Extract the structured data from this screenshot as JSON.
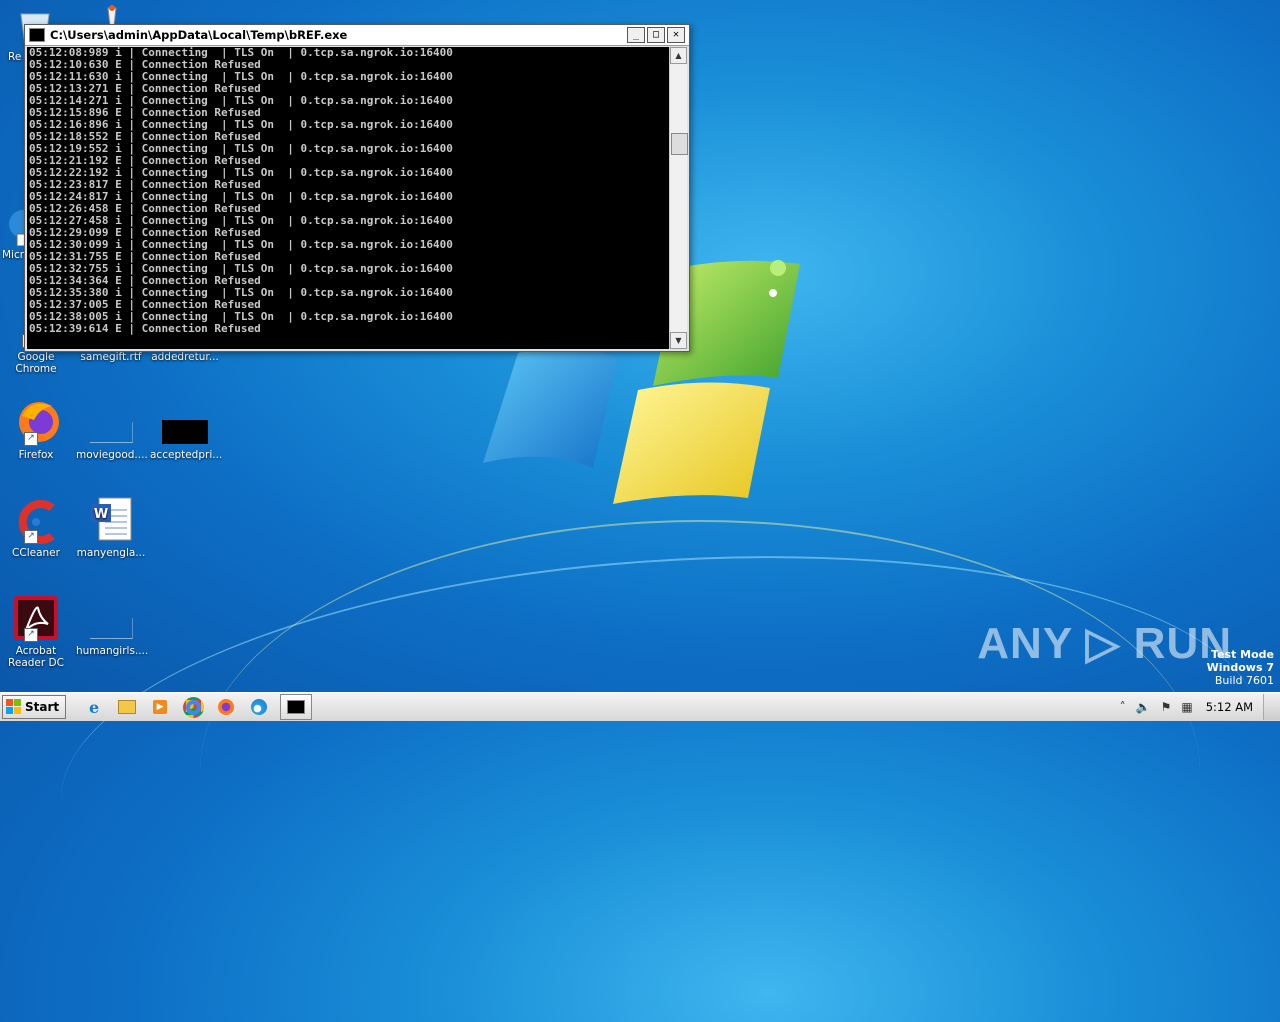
{
  "console": {
    "title": "C:\\Users\\admin\\AppData\\Local\\Temp\\bREF.exe",
    "lines": [
      "05:12:08:989 i | Connecting  | TLS On  | 0.tcp.sa.ngrok.io:16400",
      "05:12:10:630 E | Connection Refused",
      "05:12:11:630 i | Connecting  | TLS On  | 0.tcp.sa.ngrok.io:16400",
      "05:12:13:271 E | Connection Refused",
      "05:12:14:271 i | Connecting  | TLS On  | 0.tcp.sa.ngrok.io:16400",
      "05:12:15:896 E | Connection Refused",
      "05:12:16:896 i | Connecting  | TLS On  | 0.tcp.sa.ngrok.io:16400",
      "05:12:18:552 E | Connection Refused",
      "05:12:19:552 i | Connecting  | TLS On  | 0.tcp.sa.ngrok.io:16400",
      "05:12:21:192 E | Connection Refused",
      "05:12:22:192 i | Connecting  | TLS On  | 0.tcp.sa.ngrok.io:16400",
      "05:12:23:817 E | Connection Refused",
      "05:12:24:817 i | Connecting  | TLS On  | 0.tcp.sa.ngrok.io:16400",
      "05:12:26:458 E | Connection Refused",
      "05:12:27:458 i | Connecting  | TLS On  | 0.tcp.sa.ngrok.io:16400",
      "05:12:29:099 E | Connection Refused",
      "05:12:30:099 i | Connecting  | TLS On  | 0.tcp.sa.ngrok.io:16400",
      "05:12:31:755 E | Connection Refused",
      "05:12:32:755 i | Connecting  | TLS On  | 0.tcp.sa.ngrok.io:16400",
      "05:12:34:364 E | Connection Refused",
      "05:12:35:380 i | Connecting  | TLS On  | 0.tcp.sa.ngrok.io:16400",
      "05:12:37:005 E | Connection Refused",
      "05:12:38:005 i | Connecting  | TLS On  | 0.tcp.sa.ngrok.io:16400",
      "05:12:39:614 E | Connection Refused"
    ],
    "btn_min": "_",
    "btn_max": "□",
    "btn_close": "✕"
  },
  "desktop": {
    "icons": [
      {
        "label": "Re",
        "icon": "recycle-bin-icon"
      },
      {
        "label": "Micr",
        "icon": "edge-icon"
      },
      {
        "label": "Google Chrome",
        "icon": "chrome-icon"
      },
      {
        "label": "samegift.rtf",
        "icon": "rtf-file-icon"
      },
      {
        "label": "addedretur...",
        "icon": "file-icon"
      },
      {
        "label": "Firefox",
        "icon": "firefox-icon"
      },
      {
        "label": "moviegood....",
        "icon": "file-icon"
      },
      {
        "label": "acceptedpri...",
        "icon": "black-file-icon"
      },
      {
        "label": "CCleaner",
        "icon": "ccleaner-icon"
      },
      {
        "label": "manyengla...",
        "icon": "word-doc-icon"
      },
      {
        "label": "Acrobat Reader DC",
        "icon": "acrobat-icon"
      },
      {
        "label": "humangirls....",
        "icon": "file-icon"
      }
    ]
  },
  "watermark": "ANY ▷ RUN",
  "testmode": {
    "line1": "Test Mode",
    "line2": "Windows 7",
    "line3": "Build 7601"
  },
  "taskbar": {
    "start_label": "Start",
    "apps": [
      "ie-icon",
      "explorer-icon",
      "media-player-icon",
      "chrome-icon",
      "firefox-icon",
      "edge-icon",
      "console-icon"
    ],
    "clock": "5:12 AM"
  }
}
